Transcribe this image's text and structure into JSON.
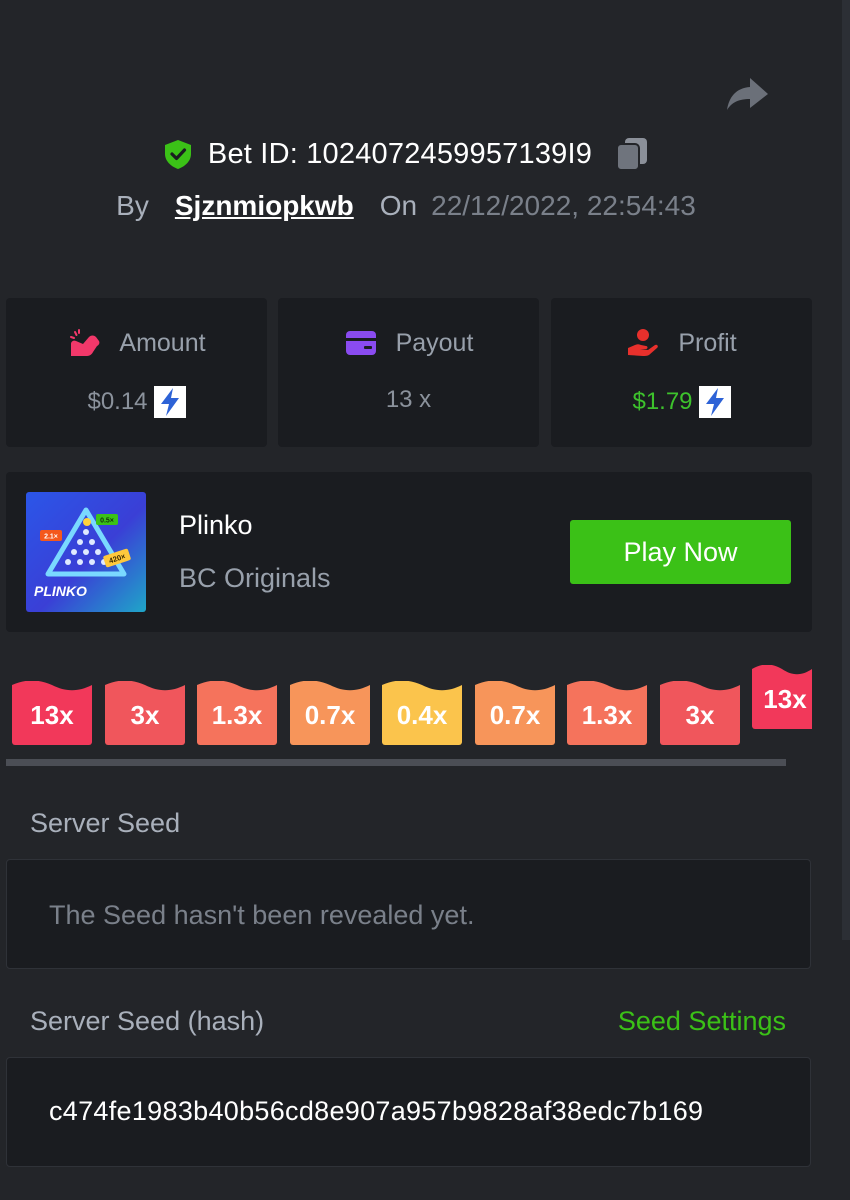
{
  "header": {
    "bet_id_label": "Bet ID: 1024072459957139I9",
    "by_label": "By",
    "username": "Sjznmiopkwb",
    "on_label": "On",
    "datetime": "22/12/2022, 22:54:43"
  },
  "stats": {
    "amount": {
      "label": "Amount",
      "value": "$0.14",
      "icon": "money-bag-icon"
    },
    "payout": {
      "label": "Payout",
      "value": "13 x",
      "icon": "card-icon"
    },
    "profit": {
      "label": "Profit",
      "value": "$1.79",
      "icon": "hand-coin-icon"
    }
  },
  "game": {
    "name": "Plinko",
    "provider": "BC Originals",
    "play_label": "Play Now",
    "thumb_text": "PLINKO",
    "thumb_badges": [
      "2.1×",
      "0.5×",
      "420×"
    ]
  },
  "multipliers": [
    {
      "label": "13x",
      "color": "#f2385a"
    },
    {
      "label": "3x",
      "color": "#f0565c"
    },
    {
      "label": "1.3x",
      "color": "#f5735c"
    },
    {
      "label": "0.7x",
      "color": "#f7955a"
    },
    {
      "label": "0.4x",
      "color": "#fbc44c"
    },
    {
      "label": "0.7x",
      "color": "#f7955a"
    },
    {
      "label": "1.3x",
      "color": "#f5735c"
    },
    {
      "label": "3x",
      "color": "#f0565c"
    },
    {
      "label": "13x",
      "color": "#f2385a"
    }
  ],
  "server_seed": {
    "label": "Server Seed",
    "value": "The Seed hasn't been revealed yet."
  },
  "server_seed_hash": {
    "label": "Server Seed (hash)",
    "settings_label": "Seed Settings",
    "value": "c474fe1983b40b56cd8e907a957b9828af38edc7b169"
  },
  "colors": {
    "background": "#232529",
    "card": "#1a1c20",
    "accent_green": "#3bc117",
    "profit_green": "#3dc22c"
  }
}
